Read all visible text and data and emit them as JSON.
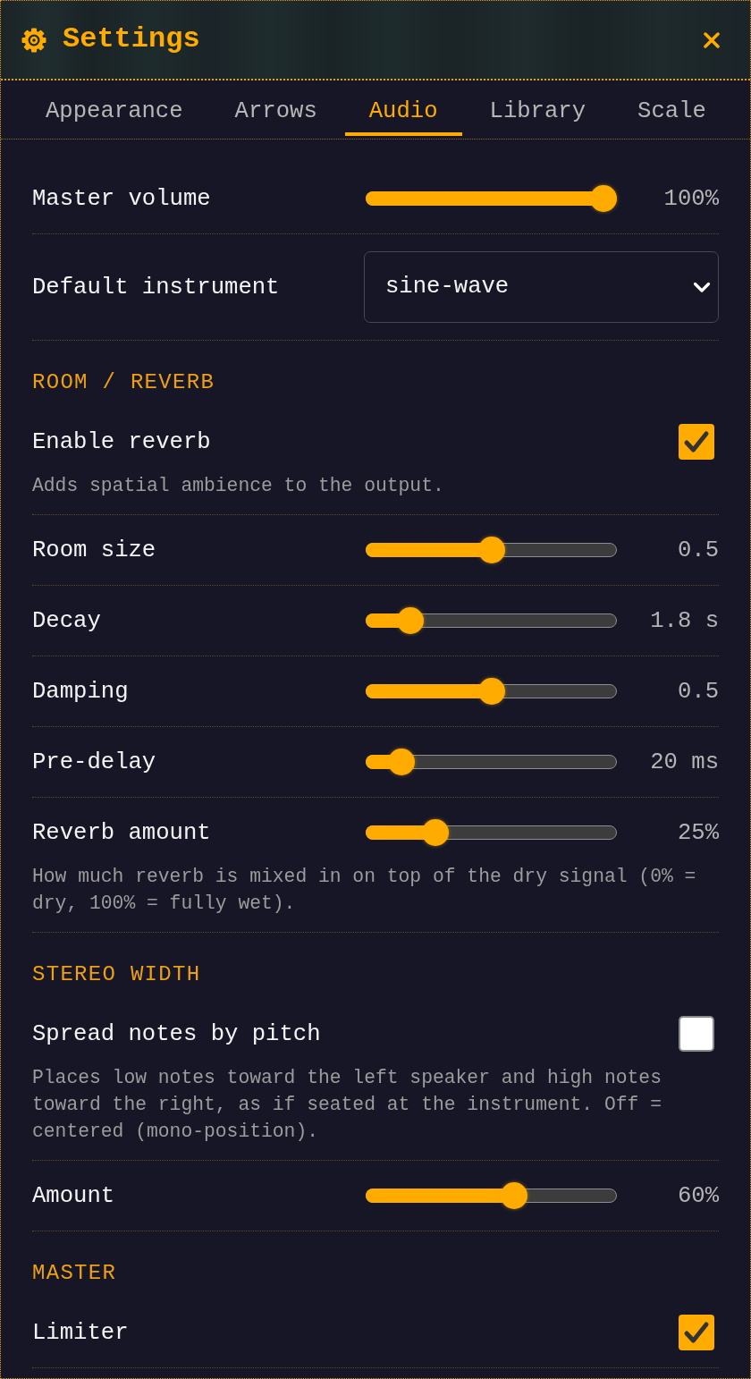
{
  "window": {
    "title": "Settings"
  },
  "tabs": [
    {
      "label": "Appearance",
      "selected": false
    },
    {
      "label": "Arrows",
      "selected": false
    },
    {
      "label": "Audio",
      "selected": true
    },
    {
      "label": "Library",
      "selected": false
    },
    {
      "label": "Scale",
      "selected": false
    }
  ],
  "rows": [
    {
      "kind": "slider",
      "label": "Master volume",
      "level": 1,
      "reading": "100%"
    },
    {
      "kind": "select",
      "label": "Default instrument",
      "value": "sine-wave"
    },
    {
      "kind": "section",
      "label": "ROOM / REVERB"
    },
    {
      "kind": "checkbox",
      "label": "Enable reverb",
      "checked": true,
      "description": "Adds spatial ambience to the output."
    },
    {
      "kind": "slider",
      "label": "Room size",
      "level": 0.5,
      "reading": "0.5"
    },
    {
      "kind": "slider",
      "label": "Decay",
      "level": 0.14,
      "reading": "1.8 s"
    },
    {
      "kind": "slider",
      "label": "Damping",
      "level": 0.5,
      "reading": "0.5"
    },
    {
      "kind": "slider",
      "label": "Pre-delay",
      "level": 0.1,
      "reading": "20 ms"
    },
    {
      "kind": "slider",
      "label": "Reverb amount",
      "level": 0.25,
      "reading": "25%",
      "description": "How much reverb is mixed in on top of the dry signal (0% = dry, 100% = fully wet)."
    },
    {
      "kind": "section",
      "label": "STEREO WIDTH"
    },
    {
      "kind": "checkbox",
      "label": "Spread notes by pitch",
      "checked": false,
      "description": "Places low notes toward the left speaker and high notes toward the right, as if seated at the instrument. Off = centered (mono-position)."
    },
    {
      "kind": "slider",
      "label": "Amount",
      "level": 0.6,
      "reading": "60%"
    },
    {
      "kind": "section",
      "label": "MASTER"
    },
    {
      "kind": "checkbox",
      "label": "Limiter",
      "checked": true
    }
  ]
}
